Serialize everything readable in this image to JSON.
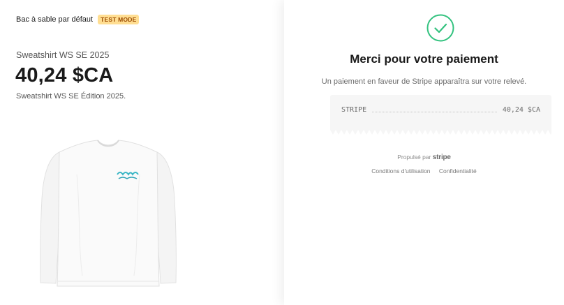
{
  "header": {
    "sandbox_label": "Bac à sable par défaut",
    "test_mode_badge": "TEST MODE"
  },
  "product": {
    "name": "Sweatshirt WS SE 2025",
    "price": "40,24 $CA",
    "description": "Sweatshirt WS SE Édition 2025."
  },
  "confirmation": {
    "title": "Merci pour votre paiement",
    "notice": "Un paiement en faveur de Stripe apparaîtra sur votre relevé.",
    "receipt": {
      "merchant": "STRIPE",
      "amount": "40,24 $CA"
    },
    "accent_color": "#33c27f"
  },
  "footer": {
    "powered_by": "Propulsé par",
    "brand": "stripe",
    "terms": "Conditions d'utilisation",
    "privacy": "Confidentialité"
  },
  "icons": {
    "success": "check-circle-icon"
  }
}
